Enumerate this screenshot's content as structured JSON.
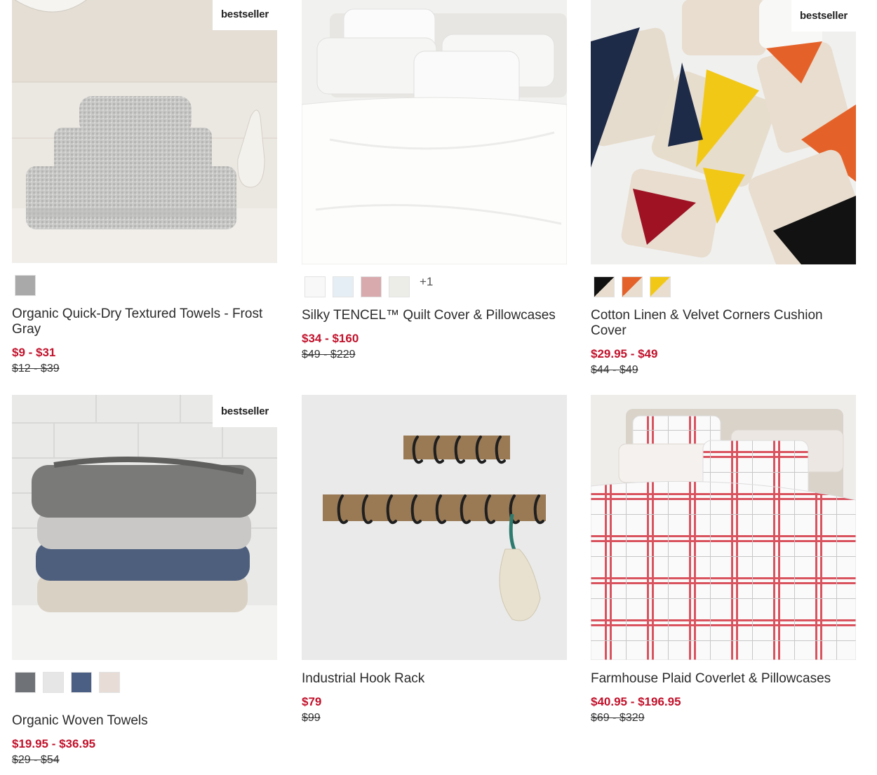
{
  "badge_label": "bestseller",
  "colors": {
    "sale": "#c2122b",
    "text": "#2b2b2b"
  },
  "products": [
    {
      "title": "Organic Quick-Dry Textured Towels - Frost Gray",
      "sale_price": "$9 - $31",
      "original_price": "$12 - $39",
      "bestseller": true,
      "swatches": [
        "#a9a9a9"
      ],
      "more_swatches": ""
    },
    {
      "title": "Silky TENCEL™ Quilt Cover & Pillowcases",
      "sale_price": "$34 - $160",
      "original_price": "$49 - $229",
      "bestseller": false,
      "swatches": [
        "#f8f8f8",
        "#e6eef5",
        "#d8a9ad",
        "#ecede6"
      ],
      "more_swatches": "+1"
    },
    {
      "title": "Cotton Linen & Velvet Corners Cushion Cover",
      "sale_price": "$29.95 - $49",
      "original_price": "$44 - $49",
      "bestseller": true,
      "swatches": [
        "split-black",
        "split-orange",
        "split-yellow"
      ],
      "more_swatches": ""
    },
    {
      "title": "Organic Woven Towels",
      "sale_price": "$19.95 - $36.95",
      "original_price": "$29 - $54",
      "bestseller": true,
      "swatches": [
        "#6f7276",
        "#e6e6e6",
        "#4a5f83",
        "#e7ddd6"
      ],
      "more_swatches": ""
    },
    {
      "title": "Industrial Hook Rack",
      "sale_price": "$79",
      "original_price": "$99",
      "bestseller": false,
      "swatches": [],
      "more_swatches": ""
    },
    {
      "title": "Farmhouse Plaid Coverlet & Pillowcases",
      "sale_price": "$40.95 - $196.95",
      "original_price": "$69 - $329",
      "bestseller": false,
      "swatches": [],
      "more_swatches": ""
    }
  ]
}
